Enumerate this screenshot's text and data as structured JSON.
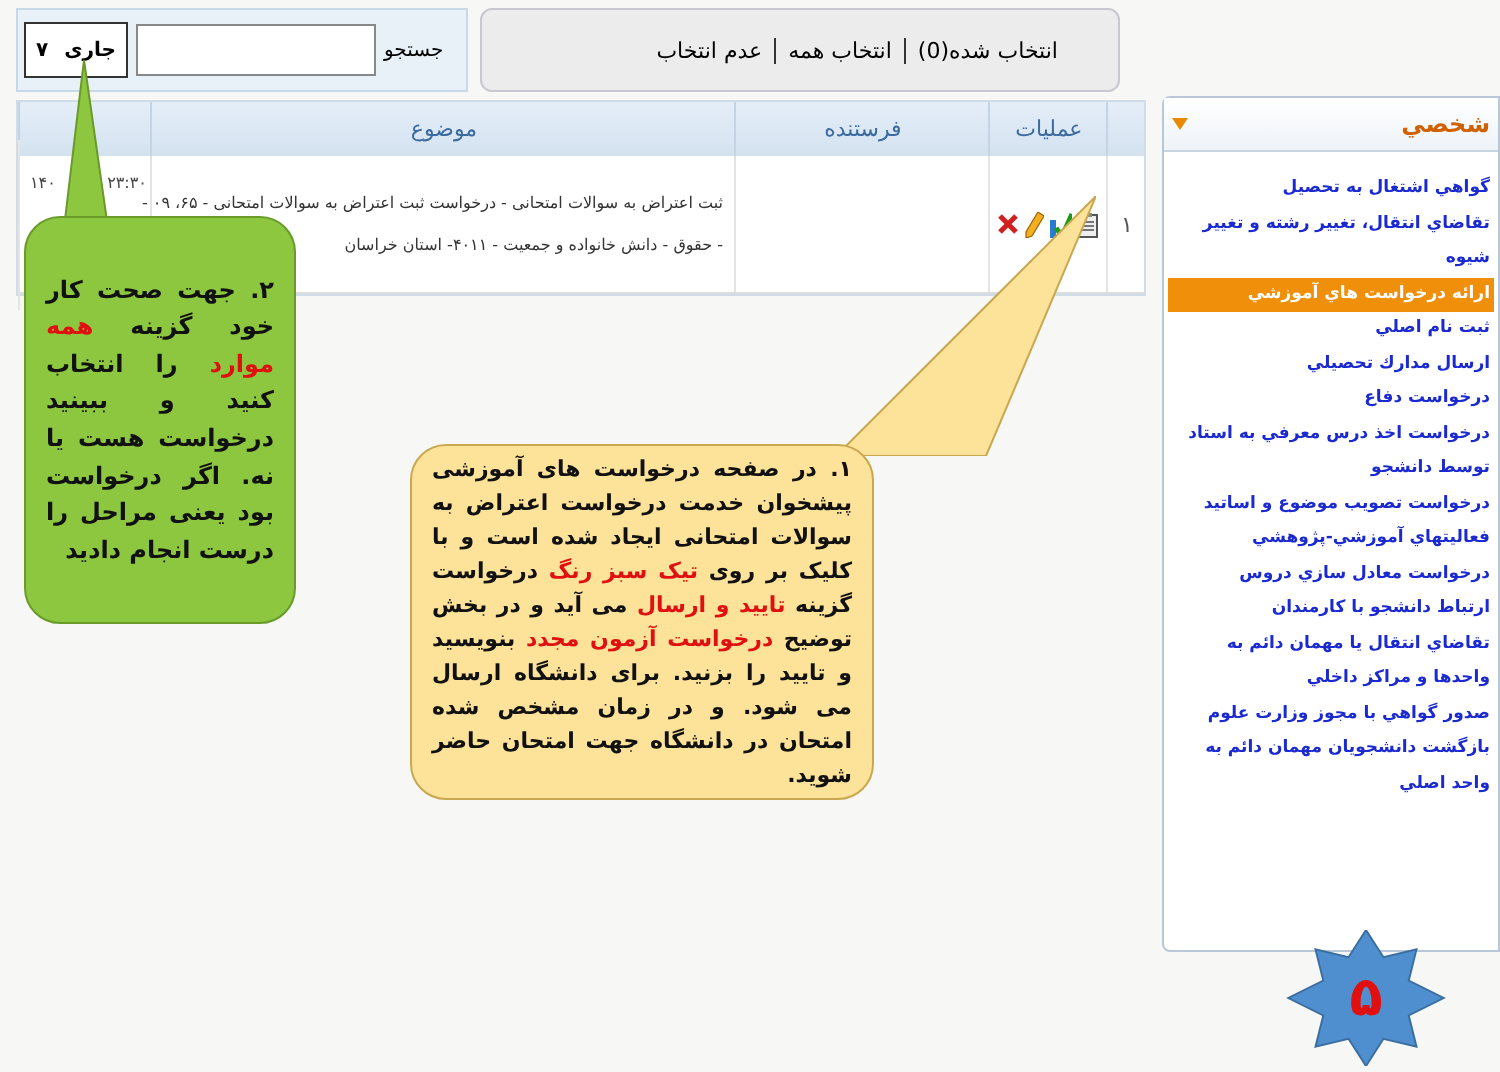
{
  "toolbar": {
    "status_select": {
      "value": "جاری",
      "count": "۷"
    },
    "search": {
      "label": "جستجو"
    },
    "selection": {
      "selected": "انتخاب شده(0)",
      "select_all": "انتخاب همه",
      "deselect": "عدم انتخاب"
    }
  },
  "table": {
    "columns": [
      "عملیات",
      "فرستنده",
      "موضوع"
    ],
    "rows": [
      {
        "number": "۱",
        "sender": "",
        "subject": [
          "ثبت اعتراض به سوالات امتحانی - درخواست ثبت اعتراض به سوالات امتحانی - ۶۵،  ۰۹ -",
          "- حقوق - دانش خانواده و جمعیت - ۴۰۱۱- استان خراسان"
        ],
        "date": "۱۴۰",
        "time": "۲۳:۳۰"
      }
    ]
  },
  "sidebar": {
    "title": "شخصي",
    "items": [
      {
        "label": "گواهي اشتغال به تحصيل",
        "selected": false
      },
      {
        "label": "تقاضاي انتقال، تغيير رشته و تغيير شيوه",
        "selected": false
      },
      {
        "label": "ارائه درخواست هاي آموزشي",
        "selected": true
      },
      {
        "label": "ثبت نام اصلي",
        "selected": false
      },
      {
        "label": "ارسال مدارك تحصيلي",
        "selected": false
      },
      {
        "label": "درخواست دفاع",
        "selected": false
      },
      {
        "label": "درخواست اخذ درس معرفي به استاد توسط دانشجو",
        "selected": false
      },
      {
        "label": "درخواست تصويب موضوع و اساتيد فعاليتهاي آموزشي-پژوهشي",
        "selected": false
      },
      {
        "label": "درخواست معادل سازي دروس",
        "selected": false
      },
      {
        "label": "ارتباط دانشجو با كارمندان",
        "selected": false
      },
      {
        "label": "تقاضاي انتقال يا مهمان دائم به واحدها و مراكز داخلي",
        "selected": false
      },
      {
        "label": "صدور گواهي با مجوز وزارت علوم",
        "selected": false
      },
      {
        "label": "بازگشت دانشجويان مهمان دائم به واحد اصلي",
        "selected": false
      }
    ]
  },
  "callouts": [
    {
      "kind": "green",
      "text": "۲. جهت صحت کار خود گزینه **همه موارد** را انتخاب کنید و ببینید درخواست هست یا نه. اگر درخواست بود یعنی مراحل را درست انجام دادید"
    },
    {
      "kind": "yellow",
      "text": "۱. در صفحه درخواست های آموزشی پیشخوان خدمت درخواست اعتراض به سوالات امتحانی ایجاد شده است و با کلیک بر روی **تیک سبز رنگ** درخواست گزینه **تایید و ارسال** می آید و در بخش توضیح **درخواست آزمون مجدد** بنویسید و تایید را بزنید. برای دانشگاه ارسال می شود. و در زمان مشخص شده امتحان در دانشگاه جهت امتحان حاضر شوید."
    }
  ],
  "step_badge": "۵"
}
